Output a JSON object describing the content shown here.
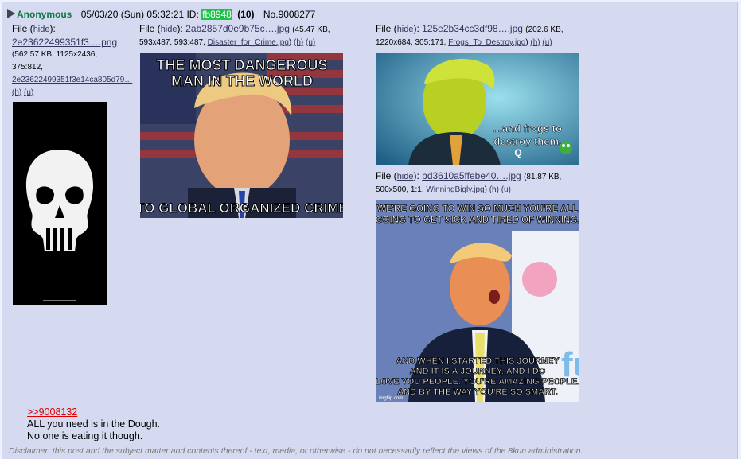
{
  "post": {
    "name": "Anonymous",
    "date": "05/03/20 (Sun) 05:32:21",
    "id_label": "ID:",
    "id": "fb8948",
    "reply_count": "(10)",
    "number": "No.9008277"
  },
  "files": [
    {
      "label": "File",
      "hide": "hide",
      "name": "2e23622499351f3….png",
      "meta": "(562.57 KB, 1125x2436,",
      "meta2": "375:812,",
      "orig": "2e23622499351f3e14ca805d79…",
      "h": "(h)",
      "u": "(u)"
    },
    {
      "label": "File",
      "hide": "hide",
      "name": "2ab2857d0e9b75c….jpg",
      "meta": "(45.47 KB,",
      "meta2": "593x487, 593:487,",
      "orig": "Disaster_for_Crime.jpg",
      "h": "(h)",
      "u": "(u)",
      "caption_top": "THE MOST DANGEROUS MAN IN THE WORLD",
      "caption_bottom": "TO GLOBAL ORGANIZED CRIME"
    },
    {
      "label": "File",
      "hide": "hide",
      "name": "125e2b34cc3df98….jpg",
      "meta": "(202.6 KB,",
      "meta2": "1220x684, 305:171,",
      "orig": "Frogs_To_Destroy.jpg",
      "h": "(h)",
      "u": "(u)",
      "caption": "...and frogs to destroy them. Q"
    },
    {
      "label": "File",
      "hide": "hide",
      "name": "bd3610a5ffebe40….jpg",
      "meta": "(81.87 KB,",
      "meta2": "500x500, 1:1,",
      "orig": "WinningBigly.jpg",
      "h": "(h)",
      "u": "(u)",
      "caption_top": "WE'RE GOING TO WIN SO MUCH YOU'RE ALL GOING TO GET SICK AND TIRED OF WINNING.",
      "caption_bottom": "AND WHEN I STARTED THIS JOURNEY AND IT IS A JOURNEY, AND I DO LOVE YOU PEOPLE. YOU'RE AMAZING PEOPLE. AND BY THE WAY YOU'RE SO SMART.",
      "watermark": "imgflip.com"
    }
  ],
  "message": {
    "quote": ">>9008132",
    "line1": "ALL you need is in the Dough.",
    "line2": "No one is eating it though."
  },
  "disclaimer": "Disclaimer: this post and the subject matter and contents thereof - text, media, or otherwise - do not necessarily reflect the views of the 8kun administration.",
  "colors": {
    "background": "#eef2ff",
    "post": "#d6daf0",
    "name": "#117743",
    "id": "#1ec24a",
    "quote": "#dd0000"
  }
}
